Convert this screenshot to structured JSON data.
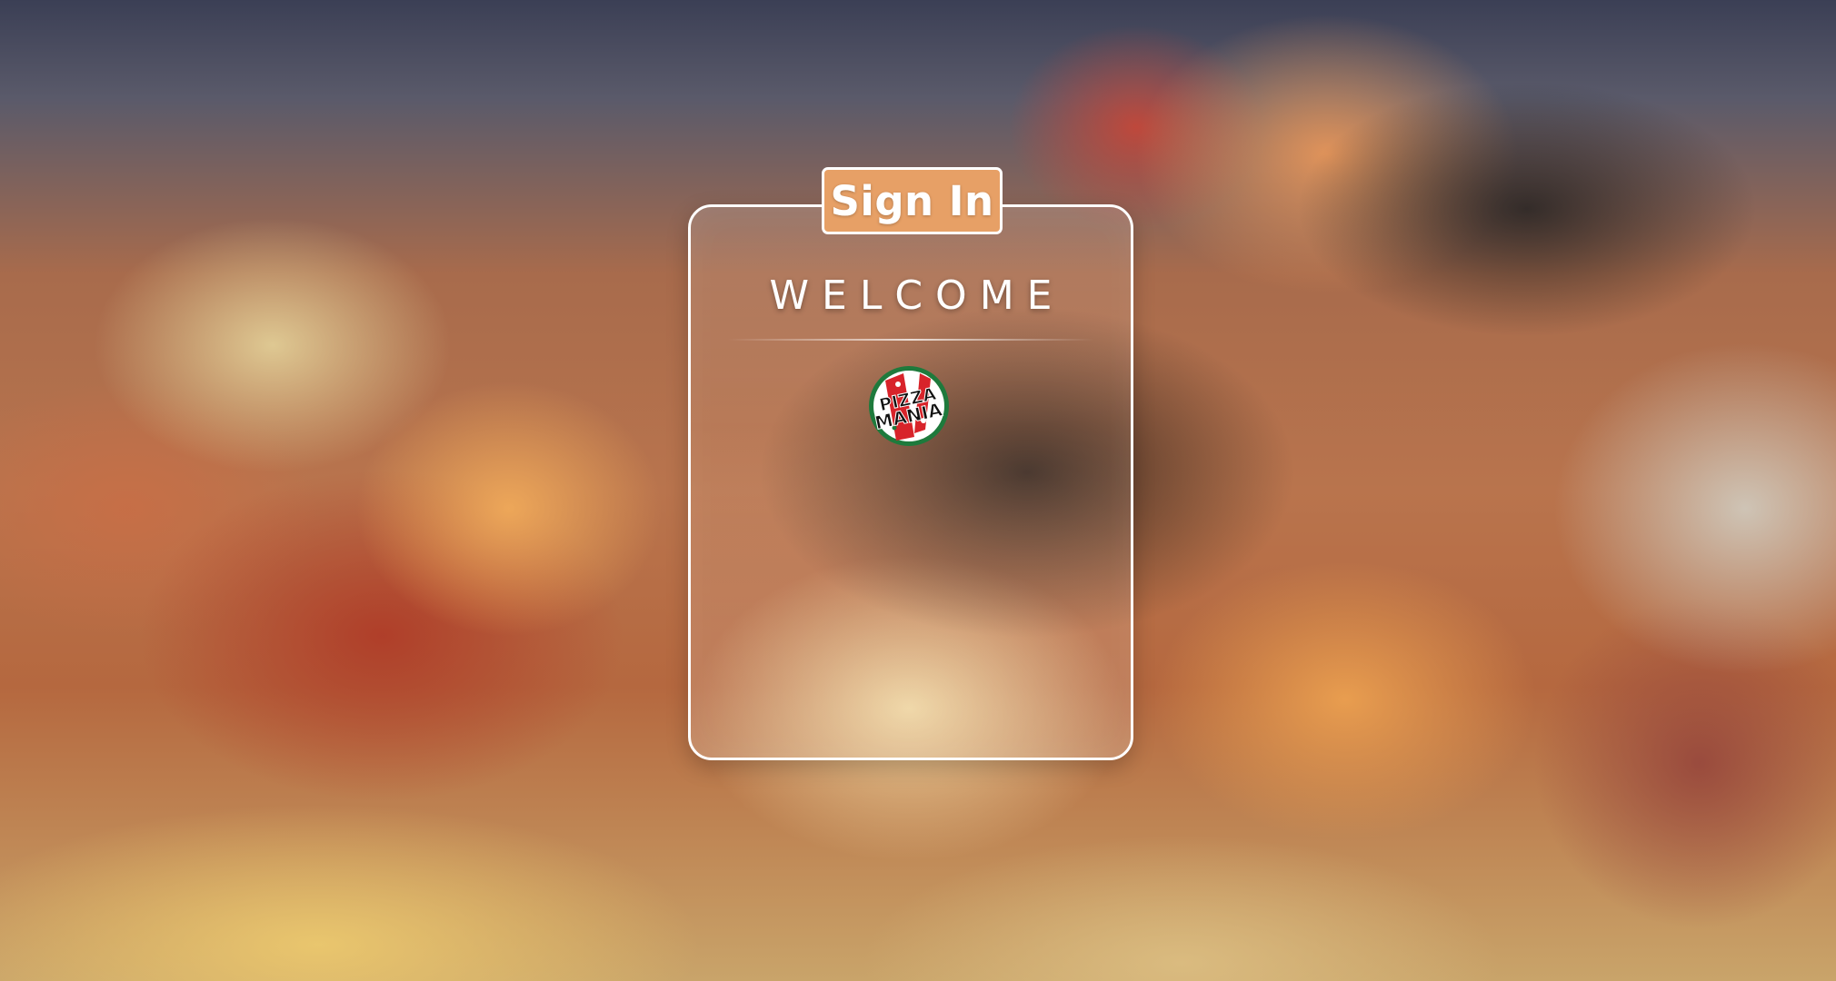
{
  "signin": {
    "tab_label": "Sign In"
  },
  "card": {
    "welcome_text": "WELCOME"
  },
  "logo": {
    "line1": "PIZZA",
    "line2": "MANIA",
    "icon": "pizza-mania-logo"
  },
  "colors": {
    "tab_accent": "#e7a066",
    "card_border": "#ffffff",
    "logo_green": "#1e7a3c",
    "logo_red": "#d8232a"
  }
}
